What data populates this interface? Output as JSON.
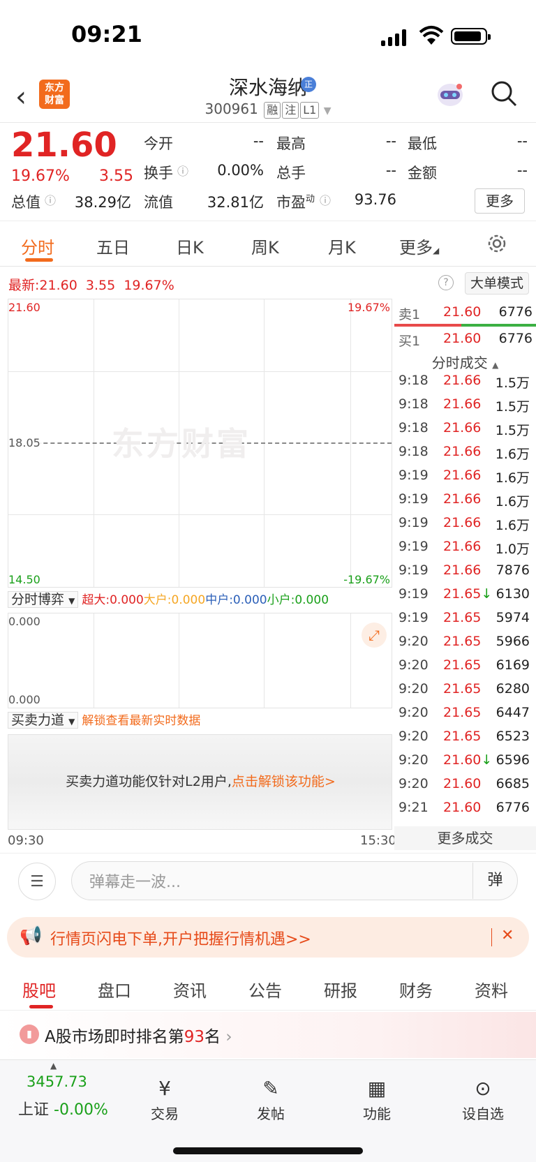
{
  "status": {
    "time": "09:21"
  },
  "header": {
    "logo": "东方财富",
    "name": "深水海纳",
    "badge": "正",
    "code": "300961",
    "tags": [
      "融",
      "注",
      "L1"
    ]
  },
  "quote": {
    "price": "21.60",
    "pct": "19.67%",
    "change": "3.55",
    "fields": [
      {
        "label": "今开",
        "value": "--"
      },
      {
        "label": "最高",
        "value": "--"
      },
      {
        "label": "最低",
        "value": "--"
      },
      {
        "label": "换手",
        "value": "0.00%"
      },
      {
        "label": "总手",
        "value": "--"
      },
      {
        "label": "金额",
        "value": "--"
      },
      {
        "label": "总值",
        "value": "38.29亿"
      },
      {
        "label": "流值",
        "value": "32.81亿"
      },
      {
        "label": "市盈",
        "sup": "动",
        "value": "93.76"
      }
    ],
    "more": "更多"
  },
  "tabs": [
    "分时",
    "五日",
    "日K",
    "周K",
    "月K",
    "更多"
  ],
  "latest": {
    "label": "最新:",
    "price": "21.60",
    "change": "3.55",
    "pct": "19.67%",
    "bigmode": "大单模式",
    "help": "?"
  },
  "chart": {
    "ymax": "21.60",
    "ymid": "18.05",
    "ymin": "14.50",
    "pmax": "19.67%",
    "pmin": "-19.67%",
    "watermark": "东方财富",
    "tstart": "09:30",
    "tend": "15:30"
  },
  "bo": {
    "sel": "分时博弈",
    "items": [
      {
        "label": "超大:0.000",
        "color": "#e02424"
      },
      {
        "label": "大户:0.000",
        "color": "#f5a623"
      },
      {
        "label": "中户:0.000",
        "color": "#2b5fb8"
      },
      {
        "label": "小户:0.000",
        "color": "#1aa01a"
      }
    ],
    "top": "0.000",
    "bottom": "0.000"
  },
  "md": {
    "sel": "买卖力道",
    "unlock": "解锁查看最新实时数据",
    "msg": "买卖力道功能仅针对L2用户,",
    "link": "点击解锁该功能>"
  },
  "orderbook": {
    "sell": {
      "label": "卖1",
      "price": "21.60",
      "vol": "6776"
    },
    "buy": {
      "label": "买1",
      "price": "21.60",
      "vol": "6776"
    }
  },
  "trades_title": "分时成交",
  "trades": [
    {
      "t": "9:18",
      "p": "21.66",
      "v": "1.5万",
      "d": ""
    },
    {
      "t": "9:18",
      "p": "21.66",
      "v": "1.5万",
      "d": ""
    },
    {
      "t": "9:18",
      "p": "21.66",
      "v": "1.5万",
      "d": ""
    },
    {
      "t": "9:18",
      "p": "21.66",
      "v": "1.6万",
      "d": ""
    },
    {
      "t": "9:19",
      "p": "21.66",
      "v": "1.6万",
      "d": ""
    },
    {
      "t": "9:19",
      "p": "21.66",
      "v": "1.6万",
      "d": ""
    },
    {
      "t": "9:19",
      "p": "21.66",
      "v": "1.6万",
      "d": ""
    },
    {
      "t": "9:19",
      "p": "21.66",
      "v": "1.0万",
      "d": ""
    },
    {
      "t": "9:19",
      "p": "21.66",
      "v": "7876",
      "d": ""
    },
    {
      "t": "9:19",
      "p": "21.65",
      "v": "6130",
      "d": "↓"
    },
    {
      "t": "9:19",
      "p": "21.65",
      "v": "5974",
      "d": ""
    },
    {
      "t": "9:20",
      "p": "21.65",
      "v": "5966",
      "d": ""
    },
    {
      "t": "9:20",
      "p": "21.65",
      "v": "6169",
      "d": ""
    },
    {
      "t": "9:20",
      "p": "21.65",
      "v": "6280",
      "d": ""
    },
    {
      "t": "9:20",
      "p": "21.65",
      "v": "6447",
      "d": ""
    },
    {
      "t": "9:20",
      "p": "21.65",
      "v": "6523",
      "d": ""
    },
    {
      "t": "9:20",
      "p": "21.60",
      "v": "6596",
      "d": "↓"
    },
    {
      "t": "9:20",
      "p": "21.60",
      "v": "6685",
      "d": ""
    },
    {
      "t": "9:21",
      "p": "21.60",
      "v": "6776",
      "d": ""
    }
  ],
  "more_trades": "更多成交",
  "danmu": {
    "placeholder": "弹幕走一波...",
    "btn": "弹"
  },
  "banner": {
    "text": "行情页闪电下单,开户把握行情机遇>>",
    "close": "✕"
  },
  "tabs2": [
    "股吧",
    "盘口",
    "资讯",
    "公告",
    "研报",
    "财务",
    "资料"
  ],
  "rank": {
    "pre": "A股市场即时排名第",
    "num": "93",
    "post": "名"
  },
  "bottom": {
    "index_value": "3457.73",
    "index_name": "上证",
    "index_pct": "-0.00%",
    "items": [
      {
        "label": "交易"
      },
      {
        "label": "发帖"
      },
      {
        "label": "功能"
      },
      {
        "label": "设自选"
      }
    ]
  }
}
